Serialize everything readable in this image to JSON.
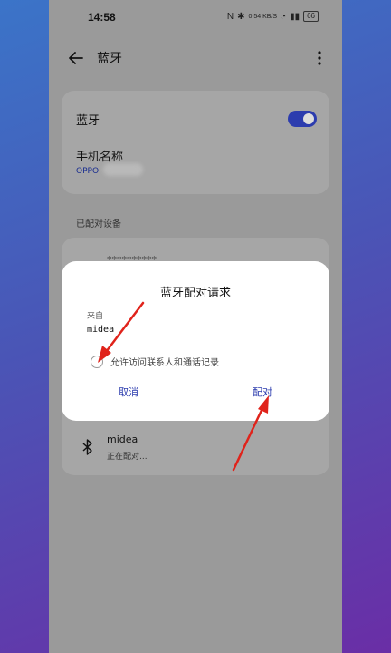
{
  "status_bar": {
    "time": "14:58",
    "network_rate": "0.54 KB/S",
    "battery": "66"
  },
  "app_bar": {
    "title": "蓝牙"
  },
  "bluetooth_card": {
    "label": "蓝牙",
    "enabled": true,
    "device_name_label": "手机名称",
    "device_name_value": "OPPO"
  },
  "paired_section": {
    "header": "已配对设备",
    "partially_hidden_device": "**********"
  },
  "pairing_device": {
    "name": "midea",
    "status": "正在配对..."
  },
  "dialog": {
    "title": "蓝牙配对请求",
    "from_label": "来自",
    "device": "midea",
    "checkbox_label": "允许访问联系人和通话记录",
    "checkbox_checked": false,
    "cancel_label": "取消",
    "pair_label": "配对"
  },
  "colors": {
    "accent": "#2c3cae",
    "annotation_arrow": "#e0231b"
  }
}
